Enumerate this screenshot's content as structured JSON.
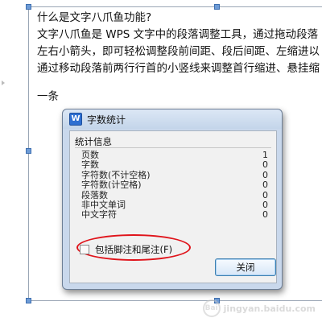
{
  "document": {
    "lines": [
      "什么是文字八爪鱼功能?",
      "文字八爪鱼是 WPS 文字中的段落调整工具，通过拖动段落",
      "左右小箭头，即可轻松调整段前间距、段后间距、左缩进以",
      "通过移动段落前两行行首的小竖线来调整首行缩进、悬挂缩"
    ],
    "last_line": "一条"
  },
  "dialog": {
    "icon_letter": "W",
    "title": "字数统计",
    "group_label": "统计信息",
    "stats": [
      {
        "label": "页数",
        "value": "1"
      },
      {
        "label": "字数",
        "value": "0"
      },
      {
        "label": "字符数(不计空格)",
        "value": "0"
      },
      {
        "label": "字符数(计空格)",
        "value": "0"
      },
      {
        "label": "段落数",
        "value": "0"
      },
      {
        "label": "非中文单词",
        "value": "0"
      },
      {
        "label": "中文字符",
        "value": "0"
      }
    ],
    "checkbox_label": "包括脚注和尾注(F)",
    "checkbox_checked": false,
    "close_label": "关闭"
  },
  "watermark": {
    "logo_letters": "Bai",
    "text": "jingyan.baidu.com"
  }
}
